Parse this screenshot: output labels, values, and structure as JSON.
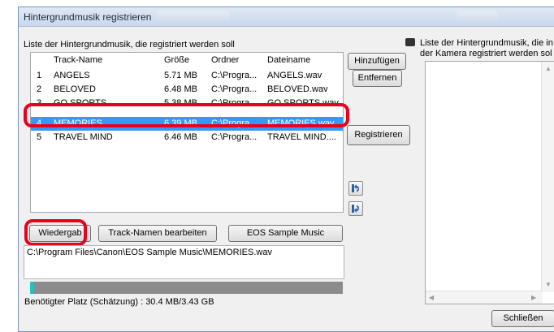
{
  "window": {
    "title": "Hintergrundmusik registrieren"
  },
  "left": {
    "heading": "Liste der Hintergrundmusik, die registriert werden soll",
    "columns": [
      "Track-Name",
      "Größe",
      "Ordner",
      "Dateiname"
    ],
    "rows": [
      {
        "num": "1",
        "name": "ANGELS",
        "size": "5.71 MB",
        "folder": "C:\\Progra...",
        "file": "ANGELS.wav"
      },
      {
        "num": "2",
        "name": "BELOVED",
        "size": "6.48 MB",
        "folder": "C:\\Progra...",
        "file": "BELOVED.wav"
      },
      {
        "num": "3",
        "name": "GO SPORTS",
        "size": "5.38 MB",
        "folder": "C:\\Progra...",
        "file": "GO SPORTS.wav"
      },
      {
        "num": "4",
        "name": "MEMORIES",
        "size": "6.39 MB",
        "folder": "C:\\Progra...",
        "file": "MEMORIES.wav"
      },
      {
        "num": "5",
        "name": "TRAVEL MIND",
        "size": "6.46 MB",
        "folder": "C:\\Progra...",
        "file": "TRAVEL MIND...."
      }
    ],
    "selected_row": "4",
    "buttons": {
      "play": "Wiedergab",
      "edit_names": "Track-Namen bearbeiten",
      "sample_music": "EOS Sample Music"
    },
    "path": "C:\\Program Files\\Canon\\EOS Sample Music\\MEMORIES.wav",
    "progress_fraction": 0.011,
    "required_space": "Benötigter Platz (Schätzung) : 30.4 MB/3.43 GB"
  },
  "middle": {
    "add": "Hinzufügen",
    "remove": "Entfernen",
    "register": "Registrieren",
    "icons": [
      "move-up-icon",
      "move-down-icon"
    ]
  },
  "right": {
    "heading_line1": "Liste der Hintergrundmusik, die in",
    "heading_line2": "der Kamera registriert werden sol",
    "close": "Schließen",
    "icons": [
      "camera-icon"
    ]
  },
  "colors": {
    "selection": "#3399ff",
    "highlight": "#e8001c",
    "progress_fill": "#19c7c7"
  }
}
